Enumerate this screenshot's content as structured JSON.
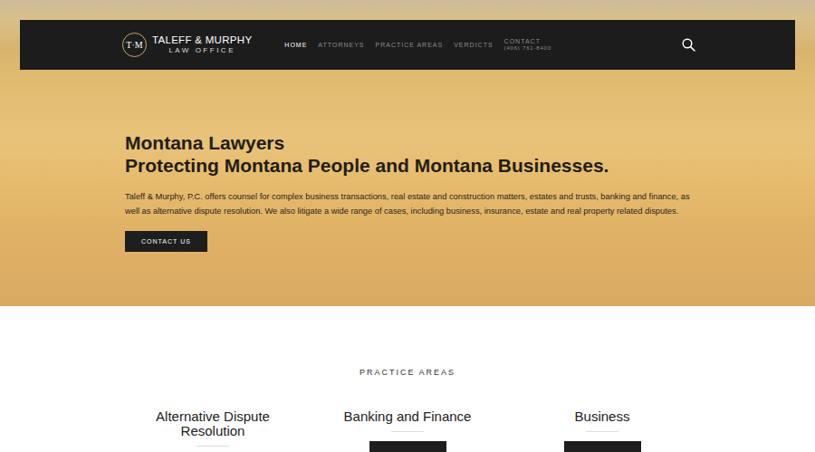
{
  "nav": {
    "logo": {
      "monogram": "T·M",
      "name": "TALEFF & MURPHY",
      "sub": "LAW OFFICE"
    },
    "items": [
      {
        "label": "HOME",
        "selected": true
      },
      {
        "label": "ATTORNEYS",
        "selected": false
      },
      {
        "label": "PRACTICE AREAS",
        "selected": false
      },
      {
        "label": "VERDICTS",
        "selected": false
      },
      {
        "label": "CONTACT",
        "sub": "(406) 761-8400",
        "selected": false
      }
    ]
  },
  "hero": {
    "heading": [
      "Montana Lawyers",
      "Protecting Montana People and Montana Businesses."
    ],
    "text": "Taleff & Murphy, P.C. offers counsel for complex business transactions, real estate and construction matters, estates and trusts, banking and finance, as well as alternative dispute resolution. We also litigate a wide range of cases, including business, insurance, estate and real property related disputes.",
    "button": "CONTACT US"
  },
  "practice_areas": {
    "title": "PRACTICE AREAS",
    "items": [
      "Alternative Dispute Resolution",
      "Banking and Finance",
      "Business"
    ]
  }
}
